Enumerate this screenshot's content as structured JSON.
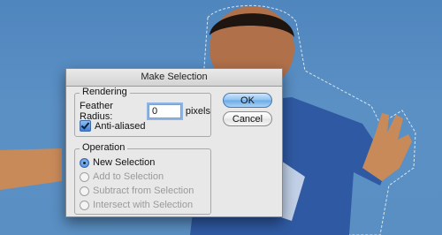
{
  "dialog": {
    "title": "Make Selection",
    "rendering": {
      "group_title": "Rendering",
      "feather_label": "Feather Radius:",
      "feather_value": "0",
      "feather_units": "pixels",
      "anti_aliased_label": "Anti-aliased",
      "anti_aliased_checked": true
    },
    "operation": {
      "group_title": "Operation",
      "options": [
        {
          "label": "New Selection",
          "selected": true,
          "enabled": true
        },
        {
          "label": "Add to Selection",
          "selected": false,
          "enabled": false
        },
        {
          "label": "Subtract from Selection",
          "selected": false,
          "enabled": false
        },
        {
          "label": "Intersect with Selection",
          "selected": false,
          "enabled": false
        }
      ]
    },
    "buttons": {
      "ok_label": "OK",
      "cancel_label": "Cancel"
    }
  },
  "colors": {
    "sky": "#5a8fc3",
    "dialog_bg": "#e8e8e8",
    "accent": "#3c7fd3"
  }
}
